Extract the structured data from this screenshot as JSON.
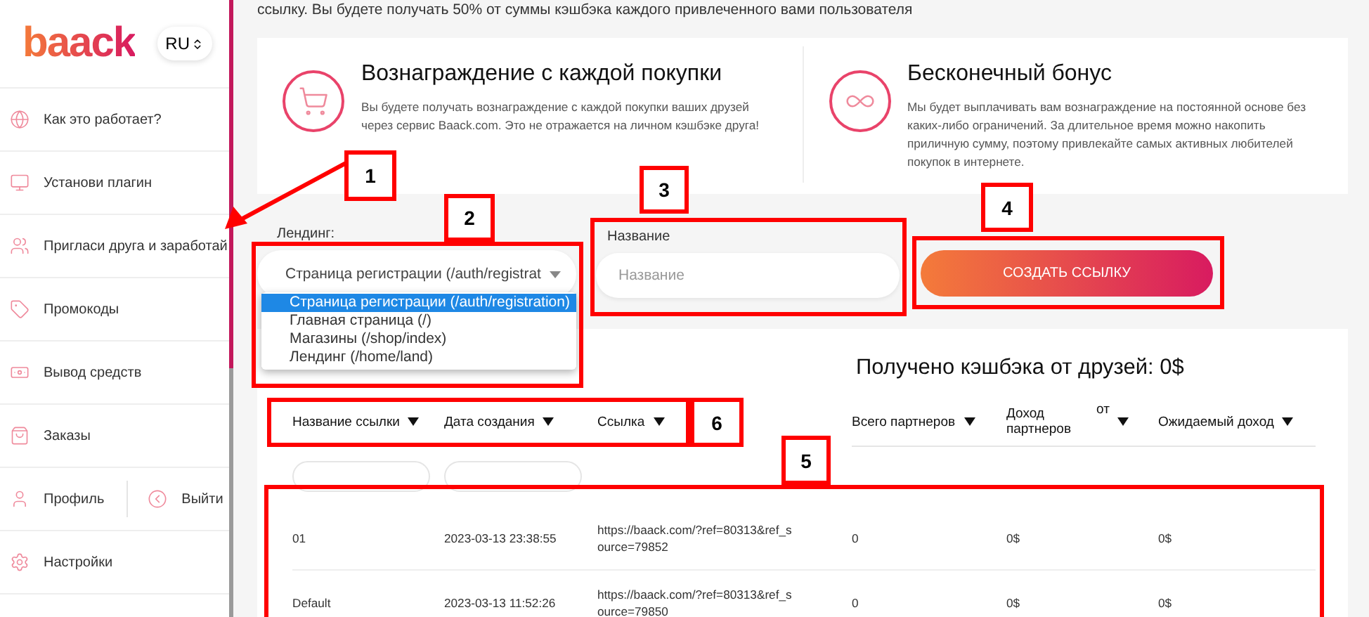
{
  "sidebar": {
    "logo": "baack",
    "language": "RU",
    "items": [
      {
        "kind": "link",
        "label": "Как это работает?"
      },
      {
        "kind": "link",
        "label": "Установи плагин"
      },
      {
        "kind": "link",
        "label": "Пригласи друга и заработай"
      },
      {
        "kind": "link",
        "label": "Промокоды"
      },
      {
        "kind": "link",
        "label": "Вывод средств"
      },
      {
        "kind": "link",
        "label": "Заказы"
      },
      {
        "kind": "split",
        "label": "Профиль",
        "second_label": "Выйти"
      },
      {
        "kind": "link",
        "label": "Настройки"
      }
    ]
  },
  "intro": "ссылку. Вы будете получать 50% от суммы кэшбэка каждого привлеченного вами пользователя",
  "features": [
    {
      "title": "Вознаграждение с каждой покупки",
      "text": "Вы будете получать вознаграждение с каждой покупки ваших друзей через сервис Baack.com. Это не отражается на личном кэшбэке друга!"
    },
    {
      "title": "Бесконечный бонус",
      "text": "Мы будет выплачивать вам вознаграждение на постоянной основе без каких-либо ограничений. За длительное время можно накопить приличную сумму, поэтому привлекайте самых активных любителей покупок в интернете."
    }
  ],
  "form": {
    "landing_label": "Лендинг:",
    "landing_value": "Страница регистрации (/auth/registrat",
    "landing_options": [
      {
        "label": "Страница регистрации (/auth/registration)",
        "selected": true
      },
      {
        "label": "Главная страница (/)",
        "selected": false
      },
      {
        "label": "Магазины (/shop/index)",
        "selected": false
      },
      {
        "label": "Лендинг (/home/land)",
        "selected": false
      }
    ],
    "name_label": "Название",
    "name_placeholder": "Название",
    "button": "СОЗДАТЬ ССЫЛКУ"
  },
  "earned_title": "Получено кэшбэка от друзей: 0$",
  "table": {
    "columns": [
      {
        "label": "Название ссылки",
        "filter": true
      },
      {
        "label": "Дата создания",
        "filter": true
      },
      {
        "label": "Ссылка",
        "filter": false
      },
      {
        "label": "Всего партнеров",
        "filter": false
      },
      {
        "label": "Доход партнеров",
        "extra": "от",
        "filter": false
      },
      {
        "label": "Ожидаемый доход",
        "filter": false
      }
    ],
    "rows": [
      [
        "01",
        "2023-03-13 23:38:55",
        "https://baack.com/?ref=80313&ref_source=79852",
        "0",
        "0$",
        "0$"
      ],
      [
        "Default",
        "2023-03-13 11:52:26",
        "https://baack.com/?ref=80313&ref_source=79850",
        "0",
        "0$",
        "0$"
      ]
    ]
  },
  "annotations": [
    {
      "label": "1"
    },
    {
      "label": "2"
    },
    {
      "label": "3"
    },
    {
      "label": "4"
    },
    {
      "label": "5"
    },
    {
      "label": "6"
    }
  ]
}
